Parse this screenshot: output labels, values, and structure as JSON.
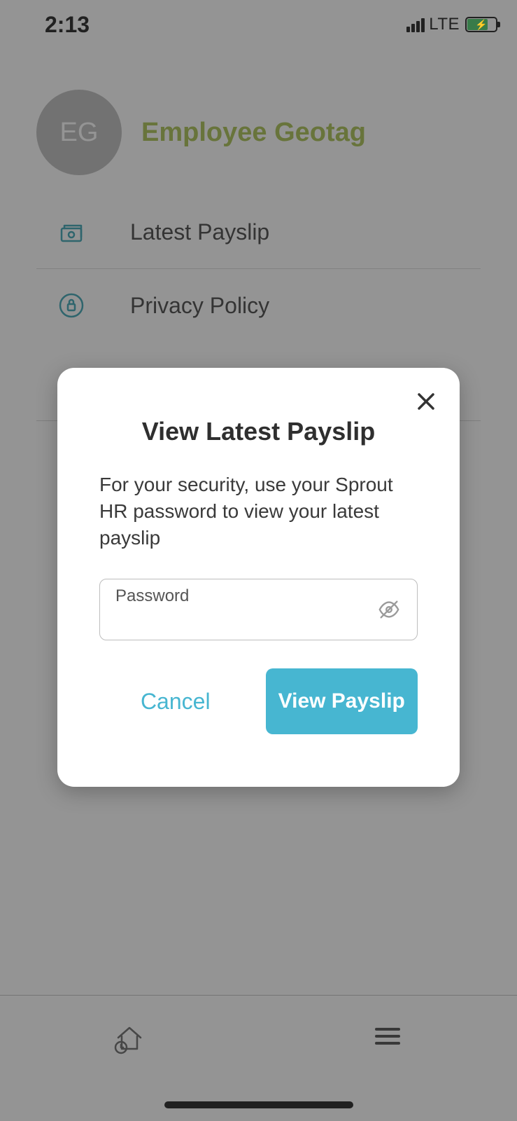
{
  "status_bar": {
    "time": "2:13",
    "network_label": "LTE"
  },
  "profile": {
    "avatar_initials": "EG",
    "name": "Employee Geotag"
  },
  "menu": {
    "items": [
      {
        "icon": "money-icon",
        "label": "Latest Payslip"
      },
      {
        "icon": "lock-icon",
        "label": "Privacy Policy"
      }
    ]
  },
  "modal": {
    "title": "View Latest Payslip",
    "description": "For your security, use your Sprout HR password to view your latest payslip",
    "password_label": "Password",
    "password_value": "",
    "cancel_label": "Cancel",
    "submit_label": "View Payslip"
  },
  "colors": {
    "accent_green": "#9db93a",
    "accent_blue": "#47b6d1",
    "icon_teal": "#1f98a8"
  }
}
